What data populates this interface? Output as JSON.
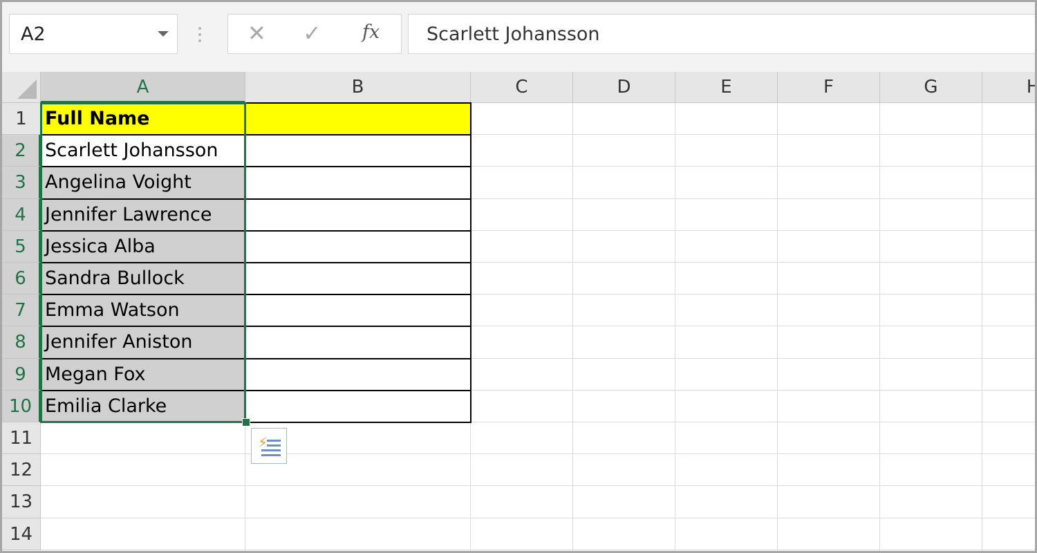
{
  "name_box": {
    "value": "A2"
  },
  "formula_bar": {
    "cancel_glyph": "✕",
    "enter_glyph": "✓",
    "function_glyph": "fx",
    "value": "Scarlett Johansson"
  },
  "columns": [
    "A",
    "B",
    "C",
    "D",
    "E",
    "F",
    "G",
    "H"
  ],
  "rows": [
    "1",
    "2",
    "3",
    "4",
    "5",
    "6",
    "7",
    "8",
    "9",
    "10",
    "11",
    "12",
    "13",
    "14"
  ],
  "header_cell": "Full Name",
  "names": [
    "Scarlett Johansson",
    "Angelina Voight",
    "Jennifer Lawrence",
    "Jessica Alba",
    "Sandra Bullock",
    "Emma Watson",
    "Jennifer Aniston",
    "Megan Fox",
    "Emilia Clarke"
  ],
  "active_cell": "A2",
  "colors": {
    "selection": "#217346",
    "header_fill": "#ffff00",
    "selected_fill": "#d0d0d0"
  },
  "icons": {
    "flash_fill_options": "flash-fill-icon"
  }
}
